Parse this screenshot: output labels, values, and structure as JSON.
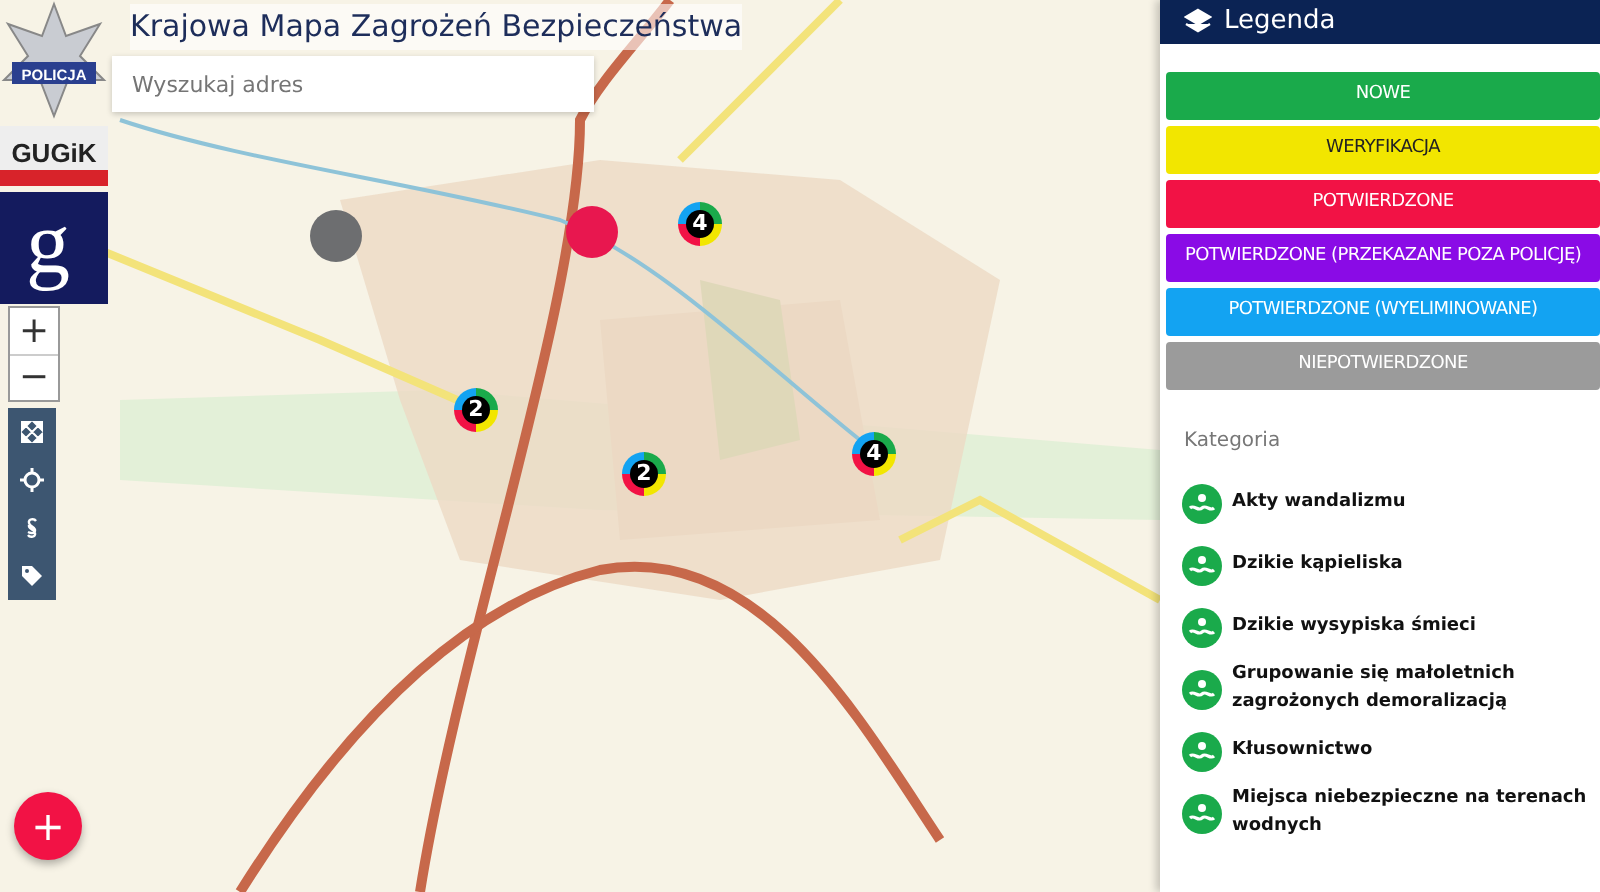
{
  "header": {
    "title": "Krajowa Mapa Zagrożeń Bezpieczeństwa"
  },
  "search": {
    "placeholder": "Wyszukaj adres"
  },
  "zoom_controls": [
    "+",
    "−"
  ],
  "logos": [
    {
      "kind": "star",
      "text": "POLICJA"
    },
    {
      "kind": "banner",
      "text": "GUGiK"
    },
    {
      "kind": "letter",
      "text": "g"
    }
  ],
  "tools": [
    {
      "kind": "fullscreen"
    },
    {
      "kind": "locate"
    },
    {
      "kind": "paragraph"
    },
    {
      "kind": "tags"
    }
  ],
  "markers": [
    {
      "kind": "category",
      "color": "#6d6e70"
    },
    {
      "kind": "category",
      "color": "#e8174f"
    },
    {
      "kind": "cluster",
      "count": "4"
    },
    {
      "kind": "cluster",
      "count": "2"
    },
    {
      "kind": "cluster",
      "count": "2"
    },
    {
      "kind": "cluster",
      "count": "4"
    }
  ],
  "add_button": {
    "label": "+"
  },
  "legend": {
    "title": "Legenda",
    "statuses": [
      {
        "label": "NOWE",
        "color": "#1aaa4b"
      },
      {
        "label": "WERYFIKACJA",
        "color": "#f2e600"
      },
      {
        "label": "POTWIERDZONE",
        "color": "#f21245"
      },
      {
        "label": "POTWIERDZONE (PRZEKAZANE POZA POLICJĘ)",
        "color": "#8a0be6"
      },
      {
        "label": "POTWIERDZONE (WYELIMINOWANE)",
        "color": "#13a3f2"
      },
      {
        "label": "NIEPOTWIERDZONE",
        "color": "#9b9b9b"
      }
    ],
    "category_heading": "Kategoria",
    "categories": [
      "Akty wandalizmu",
      "Dzikie kąpieliska",
      "Dzikie wysypiska śmieci",
      "Grupowanie się małoletnich zagrożonych demoralizacją",
      "Kłusownictwo",
      "Miejsca niebezpieczne na terenach wodnych"
    ]
  }
}
